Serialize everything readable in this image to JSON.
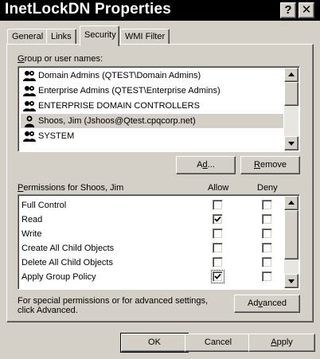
{
  "window": {
    "title": "InetLockDN Properties",
    "help_glyph": "?",
    "close_glyph": "✕"
  },
  "tabs": [
    {
      "label": "General",
      "active": false
    },
    {
      "label": "Links",
      "active": false
    },
    {
      "label": "Security",
      "active": true
    },
    {
      "label": "WMI Filter",
      "active": false
    }
  ],
  "users_section": {
    "label_mnemonic": "G",
    "label_rest": "roup or user names:",
    "items": [
      {
        "name": "Domain Admins (QTEST\\Domain Admins)",
        "icon": "user-group-icon",
        "selected": false
      },
      {
        "name": "Enterprise Admins (QTEST\\Enterprise Admins)",
        "icon": "user-group-icon",
        "selected": false
      },
      {
        "name": "ENTERPRISE DOMAIN CONTROLLERS",
        "icon": "user-group-icon",
        "selected": false
      },
      {
        "name": "Shoos, Jim (Jshoos@Qtest.cpqcorp.net)",
        "icon": "user-icon",
        "selected": true
      },
      {
        "name": "SYSTEM",
        "icon": "user-group-icon",
        "selected": false
      }
    ]
  },
  "buttons": {
    "add_mnemonic": "d",
    "add_pre": "A",
    "add_post": "d...",
    "remove_mnemonic": "R",
    "remove_rest": "emove",
    "advanced_pre": "Ad",
    "advanced_mnemonic": "v",
    "advanced_post": "anced",
    "ok": "OK",
    "cancel": "Cancel",
    "apply_mnemonic": "A",
    "apply_rest": "pply"
  },
  "permissions": {
    "label_pre": "",
    "label_mnemonic": "P",
    "label_rest": "ermissions for Shoos, Jim",
    "allow_header": "Allow",
    "deny_header": "Deny",
    "rows": [
      {
        "name": "Full Control",
        "allow": false,
        "deny": false
      },
      {
        "name": "Read",
        "allow": true,
        "deny": false
      },
      {
        "name": "Write",
        "allow": false,
        "deny": false
      },
      {
        "name": "Create All Child Objects",
        "allow": false,
        "deny": false
      },
      {
        "name": "Delete All Child Objects",
        "allow": false,
        "deny": false
      },
      {
        "name": "Apply Group Policy",
        "allow": true,
        "deny": false
      }
    ]
  },
  "advanced_note": {
    "line1": "For special permissions or for advanced settings,",
    "line2": "click Advanced."
  }
}
